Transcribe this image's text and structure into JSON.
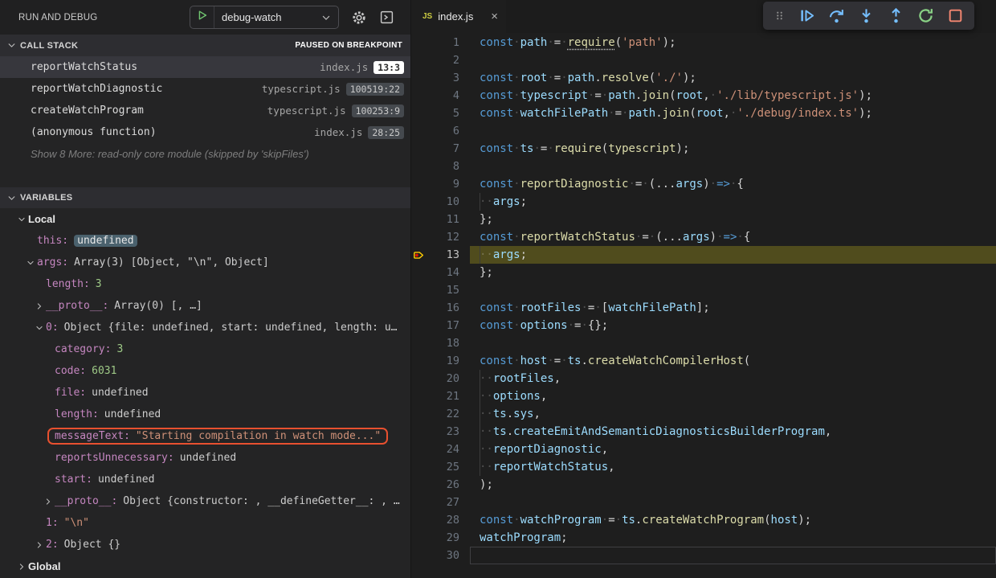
{
  "panel": {
    "title": "RUN AND DEBUG",
    "config_name": "debug-watch",
    "callstack": {
      "header": "CALL STACK",
      "status": "PAUSED ON BREAKPOINT",
      "frames": [
        {
          "name": "reportWatchStatus",
          "file": "index.js",
          "pos": "13:3",
          "selected": true,
          "badge": "light"
        },
        {
          "name": "reportWatchDiagnostic",
          "file": "typescript.js",
          "pos": "100519:22",
          "selected": false,
          "badge": "dark"
        },
        {
          "name": "createWatchProgram",
          "file": "typescript.js",
          "pos": "100253:9",
          "selected": false,
          "badge": "dark"
        },
        {
          "name": "(anonymous function)",
          "file": "index.js",
          "pos": "28:25",
          "selected": false,
          "badge": "dark"
        }
      ],
      "more": "Show 8 More: read-only core module (skipped by 'skipFiles')"
    },
    "variables": {
      "header": "VARIABLES",
      "rows": [
        {
          "level": 1,
          "chev": "down",
          "name": "Local",
          "scope": true
        },
        {
          "level": 2,
          "chev": "none",
          "name": "this",
          "value": "undefined",
          "vclass": "sel"
        },
        {
          "level": 2,
          "chev": "down",
          "name": "args",
          "value": "Array(3) [Object, \"\\n\", Object]"
        },
        {
          "level": 3,
          "chev": "none",
          "name": "length",
          "value": "3",
          "vclass": "num"
        },
        {
          "level": 3,
          "chev": "right",
          "name": "__proto__",
          "value": "Array(0) [, …]"
        },
        {
          "level": 3,
          "chev": "down",
          "name": "0",
          "value": "Object {file: undefined, start: undefined, length: u…"
        },
        {
          "level": 4,
          "chev": "none",
          "name": "category",
          "value": "3",
          "vclass": "num"
        },
        {
          "level": 4,
          "chev": "none",
          "name": "code",
          "value": "6031",
          "vclass": "num"
        },
        {
          "level": 4,
          "chev": "none",
          "name": "file",
          "value": "undefined"
        },
        {
          "level": 4,
          "chev": "none",
          "name": "length",
          "value": "undefined"
        },
        {
          "level": 4,
          "chev": "none",
          "name": "messageText",
          "value": "\"Starting compilation in watch mode...\"",
          "vclass": "str",
          "boxed": true
        },
        {
          "level": 4,
          "chev": "none",
          "name": "reportsUnnecessary",
          "value": "undefined"
        },
        {
          "level": 4,
          "chev": "none",
          "name": "start",
          "value": "undefined"
        },
        {
          "level": 4,
          "chev": "right",
          "name": "__proto__",
          "value": "Object {constructor: , __defineGetter__: , …"
        },
        {
          "level": 3,
          "chev": "none",
          "name": "1",
          "value": "\"\\n\"",
          "vclass": "str"
        },
        {
          "level": 3,
          "chev": "right",
          "name": "2",
          "value": "Object {}"
        },
        {
          "level": 1,
          "chev": "right",
          "name": "Global",
          "scope": true
        }
      ]
    }
  },
  "editor": {
    "tab": {
      "label": "index.js",
      "icon": "js"
    },
    "toolbar": [
      {
        "name": "drag-handle"
      },
      {
        "name": "continue"
      },
      {
        "name": "step-over"
      },
      {
        "name": "step-into"
      },
      {
        "name": "step-out"
      },
      {
        "name": "restart"
      },
      {
        "name": "stop"
      }
    ],
    "lines": [
      {
        "n": 1,
        "t": [
          [
            "k",
            "const"
          ],
          [
            "w",
            "·"
          ],
          [
            "v",
            "path"
          ],
          [
            "w",
            "·"
          ],
          [
            "p",
            "="
          ],
          [
            "w",
            "·"
          ],
          [
            "fu",
            "require"
          ],
          [
            "p",
            "("
          ],
          [
            "s",
            "'path'"
          ],
          [
            "p",
            ")"
          ],
          [
            "p",
            ";"
          ]
        ]
      },
      {
        "n": 2,
        "t": []
      },
      {
        "n": 3,
        "t": [
          [
            "k",
            "const"
          ],
          [
            "w",
            "·"
          ],
          [
            "v",
            "root"
          ],
          [
            "w",
            "·"
          ],
          [
            "p",
            "="
          ],
          [
            "w",
            "·"
          ],
          [
            "v",
            "path"
          ],
          [
            "p",
            "."
          ],
          [
            "f",
            "resolve"
          ],
          [
            "p",
            "("
          ],
          [
            "s",
            "'./'"
          ],
          [
            "p",
            ")"
          ],
          [
            "p",
            ";"
          ]
        ]
      },
      {
        "n": 4,
        "t": [
          [
            "k",
            "const"
          ],
          [
            "w",
            "·"
          ],
          [
            "v",
            "typescript"
          ],
          [
            "w",
            "·"
          ],
          [
            "p",
            "="
          ],
          [
            "w",
            "·"
          ],
          [
            "v",
            "path"
          ],
          [
            "p",
            "."
          ],
          [
            "f",
            "join"
          ],
          [
            "p",
            "("
          ],
          [
            "v",
            "root"
          ],
          [
            "p",
            ","
          ],
          [
            "w",
            "·"
          ],
          [
            "s",
            "'./lib/typescript.js'"
          ],
          [
            "p",
            ")"
          ],
          [
            "p",
            ";"
          ]
        ]
      },
      {
        "n": 5,
        "t": [
          [
            "k",
            "const"
          ],
          [
            "w",
            "·"
          ],
          [
            "v",
            "watchFilePath"
          ],
          [
            "w",
            "·"
          ],
          [
            "p",
            "="
          ],
          [
            "w",
            "·"
          ],
          [
            "v",
            "path"
          ],
          [
            "p",
            "."
          ],
          [
            "f",
            "join"
          ],
          [
            "p",
            "("
          ],
          [
            "v",
            "root"
          ],
          [
            "p",
            ","
          ],
          [
            "w",
            "·"
          ],
          [
            "s",
            "'./debug/index.ts'"
          ],
          [
            "p",
            ")"
          ],
          [
            "p",
            ";"
          ]
        ]
      },
      {
        "n": 6,
        "t": []
      },
      {
        "n": 7,
        "t": [
          [
            "k",
            "const"
          ],
          [
            "w",
            "·"
          ],
          [
            "v",
            "ts"
          ],
          [
            "w",
            "·"
          ],
          [
            "p",
            "="
          ],
          [
            "w",
            "·"
          ],
          [
            "f",
            "require"
          ],
          [
            "p",
            "("
          ],
          [
            "f",
            "typescript"
          ],
          [
            "p",
            ")"
          ],
          [
            "p",
            ";"
          ]
        ]
      },
      {
        "n": 8,
        "t": []
      },
      {
        "n": 9,
        "t": [
          [
            "k",
            "const"
          ],
          [
            "w",
            "·"
          ],
          [
            "f",
            "reportDiagnostic"
          ],
          [
            "w",
            "·"
          ],
          [
            "p",
            "="
          ],
          [
            "w",
            "·"
          ],
          [
            "p",
            "("
          ],
          [
            "p",
            "..."
          ],
          [
            "v",
            "args"
          ],
          [
            "p",
            ")"
          ],
          [
            "w",
            "·"
          ],
          [
            "k",
            "=>"
          ],
          [
            "w",
            "·"
          ],
          [
            "p",
            "{"
          ]
        ]
      },
      {
        "n": 10,
        "g": true,
        "t": [
          [
            "w",
            "··"
          ],
          [
            "v",
            "args"
          ],
          [
            "p",
            ";"
          ]
        ]
      },
      {
        "n": 11,
        "t": [
          [
            "p",
            "};"
          ]
        ]
      },
      {
        "n": 12,
        "t": [
          [
            "k",
            "const"
          ],
          [
            "w",
            "·"
          ],
          [
            "f",
            "reportWatchStatus"
          ],
          [
            "w",
            "·"
          ],
          [
            "p",
            "="
          ],
          [
            "w",
            "·"
          ],
          [
            "p",
            "("
          ],
          [
            "p",
            "..."
          ],
          [
            "v",
            "args"
          ],
          [
            "p",
            ")"
          ],
          [
            "w",
            "·"
          ],
          [
            "k",
            "=>"
          ],
          [
            "w",
            "·"
          ],
          [
            "p",
            "{"
          ]
        ]
      },
      {
        "n": 13,
        "g": true,
        "hl": true,
        "bp": true,
        "t": [
          [
            "w",
            "··"
          ],
          [
            "v",
            "args"
          ],
          [
            "p",
            ";"
          ]
        ]
      },
      {
        "n": 14,
        "t": [
          [
            "p",
            "};"
          ]
        ]
      },
      {
        "n": 15,
        "t": []
      },
      {
        "n": 16,
        "t": [
          [
            "k",
            "const"
          ],
          [
            "w",
            "·"
          ],
          [
            "v",
            "rootFiles"
          ],
          [
            "w",
            "·"
          ],
          [
            "p",
            "="
          ],
          [
            "w",
            "·"
          ],
          [
            "p",
            "["
          ],
          [
            "v",
            "watchFilePath"
          ],
          [
            "p",
            "]"
          ],
          [
            "p",
            ";"
          ]
        ]
      },
      {
        "n": 17,
        "t": [
          [
            "k",
            "const"
          ],
          [
            "w",
            "·"
          ],
          [
            "v",
            "options"
          ],
          [
            "w",
            "·"
          ],
          [
            "p",
            "="
          ],
          [
            "w",
            "·"
          ],
          [
            "p",
            "{}"
          ],
          [
            "p",
            ";"
          ]
        ]
      },
      {
        "n": 18,
        "t": []
      },
      {
        "n": 19,
        "t": [
          [
            "k",
            "const"
          ],
          [
            "w",
            "·"
          ],
          [
            "v",
            "host"
          ],
          [
            "w",
            "·"
          ],
          [
            "p",
            "="
          ],
          [
            "w",
            "·"
          ],
          [
            "v",
            "ts"
          ],
          [
            "p",
            "."
          ],
          [
            "f",
            "createWatchCompilerHost"
          ],
          [
            "p",
            "("
          ]
        ]
      },
      {
        "n": 20,
        "g": true,
        "t": [
          [
            "w",
            "··"
          ],
          [
            "v",
            "rootFiles"
          ],
          [
            "p",
            ","
          ]
        ]
      },
      {
        "n": 21,
        "g": true,
        "t": [
          [
            "w",
            "··"
          ],
          [
            "v",
            "options"
          ],
          [
            "p",
            ","
          ]
        ]
      },
      {
        "n": 22,
        "g": true,
        "t": [
          [
            "w",
            "··"
          ],
          [
            "v",
            "ts"
          ],
          [
            "p",
            "."
          ],
          [
            "v",
            "sys"
          ],
          [
            "p",
            ","
          ]
        ]
      },
      {
        "n": 23,
        "g": true,
        "t": [
          [
            "w",
            "··"
          ],
          [
            "v",
            "ts"
          ],
          [
            "p",
            "."
          ],
          [
            "v",
            "createEmitAndSemanticDiagnosticsBuilderProgram"
          ],
          [
            "p",
            ","
          ]
        ]
      },
      {
        "n": 24,
        "g": true,
        "t": [
          [
            "w",
            "··"
          ],
          [
            "v",
            "reportDiagnostic"
          ],
          [
            "p",
            ","
          ]
        ]
      },
      {
        "n": 25,
        "g": true,
        "t": [
          [
            "w",
            "··"
          ],
          [
            "v",
            "reportWatchStatus"
          ],
          [
            "p",
            ","
          ]
        ]
      },
      {
        "n": 26,
        "t": [
          [
            "p",
            ")"
          ],
          [
            "p",
            ";"
          ]
        ]
      },
      {
        "n": 27,
        "t": []
      },
      {
        "n": 28,
        "t": [
          [
            "k",
            "const"
          ],
          [
            "w",
            "·"
          ],
          [
            "v",
            "watchProgram"
          ],
          [
            "w",
            "·"
          ],
          [
            "p",
            "="
          ],
          [
            "w",
            "·"
          ],
          [
            "v",
            "ts"
          ],
          [
            "p",
            "."
          ],
          [
            "f",
            "createWatchProgram"
          ],
          [
            "p",
            "("
          ],
          [
            "v",
            "host"
          ],
          [
            "p",
            ")"
          ],
          [
            "p",
            ";"
          ]
        ]
      },
      {
        "n": 29,
        "t": [
          [
            "v",
            "watchProgram"
          ],
          [
            "p",
            ";"
          ]
        ]
      },
      {
        "n": 30,
        "cur": true,
        "t": []
      }
    ]
  },
  "colors": {
    "keyword": "#569cd6",
    "variable": "#9cdcfe",
    "function": "#dcdcaa",
    "string": "#ce9178",
    "number": "#9fca87",
    "property": "#c586c0",
    "line_highlight": "#504c1d",
    "annotation_box": "#e8502f",
    "value_selection": "#4a616d",
    "toolbar_blue": "#75beff",
    "toolbar_green": "#89d185",
    "toolbar_red": "#f48771",
    "play_green": "#71c671",
    "badge_light_bg": "#ffffff",
    "badge_dark_bg": "#45494e",
    "sidebar_bg": "#242425",
    "editor_bg": "#1e1e1e",
    "section_header_bg": "#2d2d31",
    "selected_row_bg": "#37373d",
    "breakpoint_yellow": "#ffcc00",
    "breakpoint_red": "#e51400"
  }
}
